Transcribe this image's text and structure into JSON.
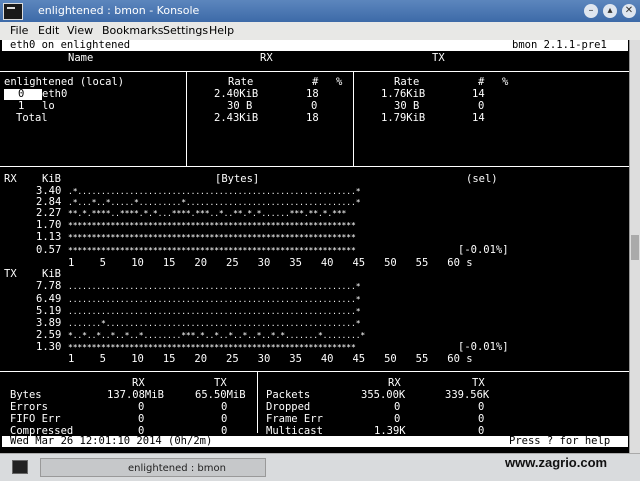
{
  "window": {
    "title": "enlightened : bmon - Konsole"
  },
  "menu": [
    "File",
    "Edit",
    "View",
    "Bookmarks",
    "Settings",
    "Help"
  ],
  "header": {
    "left": "eth0 on enlightened",
    "right": "bmon 2.1.1-pre1"
  },
  "cols": {
    "name": "Name",
    "rx": "RX",
    "tx": "TX"
  },
  "iface": {
    "host": "enlightened (local)",
    "rate_label": "Rate",
    "hash_label": "#",
    "pct_label": "%",
    "rows": [
      {
        "id": "0",
        "name": "eth0",
        "rx_rate": "2.40KiB",
        "rx_n": "18",
        "tx_rate": "1.76KiB",
        "tx_n": "14"
      },
      {
        "id": "1",
        "name": "lo",
        "rx_rate": "30 B",
        "rx_n": "0",
        "tx_rate": "30 B",
        "tx_n": "0"
      },
      {
        "id": "",
        "name": "Total",
        "rx_rate": "2.43KiB",
        "rx_n": "18",
        "tx_rate": "1.79KiB",
        "tx_n": "14"
      }
    ]
  },
  "graph": {
    "rx_label": "RX",
    "tx_label": "TX",
    "unit": "KiB",
    "title": "[Bytes]",
    "sel": "(sel)",
    "rx_rows": [
      {
        "v": "3.40",
        "s": ".*...........................................................*"
      },
      {
        "v": "2.84",
        "s": ".*...*..*.....*.........*....................................*"
      },
      {
        "v": "2.27",
        "s": "**.*.****..****.*.*...****.***..*..**.*.*......***.**.*.***"
      },
      {
        "v": "1.70",
        "s": "*************************************************************"
      },
      {
        "v": "1.13",
        "s": "*************************************************************"
      },
      {
        "v": "0.57",
        "s": "*************************************************************"
      }
    ],
    "rx_pct": "[-0.01%]",
    "tx_rows": [
      {
        "v": "7.78",
        "s": ".............................................................*"
      },
      {
        "v": "6.49",
        "s": ".............................................................*"
      },
      {
        "v": "5.19",
        "s": ".............................................................*"
      },
      {
        "v": "3.89",
        "s": ".......*.....................................................*"
      },
      {
        "v": "2.59",
        "s": "*..*..*..*..*..*........***.*..*..*..*..*..*.*.......*........*"
      },
      {
        "v": "1.30",
        "s": "*************************************************************"
      }
    ],
    "tx_pct": "[-0.01%]",
    "xaxis": "1    5    10   15   20   25   30   35   40   45   50   55   60 s"
  },
  "stats": {
    "rx": "RX",
    "tx": "TX",
    "left": [
      {
        "k": "Bytes",
        "rx": "137.08MiB",
        "tx": "65.50MiB"
      },
      {
        "k": "Errors",
        "rx": "0",
        "tx": "0"
      },
      {
        "k": "FIFO Err",
        "rx": "0",
        "tx": "0"
      },
      {
        "k": "Compressed",
        "rx": "0",
        "tx": "0"
      }
    ],
    "right": [
      {
        "k": "Packets",
        "rx": "355.00K",
        "tx": "339.56K"
      },
      {
        "k": "Dropped",
        "rx": "0",
        "tx": "0"
      },
      {
        "k": "Frame Err",
        "rx": "0",
        "tx": "0"
      },
      {
        "k": "Multicast",
        "rx": "1.39K",
        "tx": "0"
      }
    ]
  },
  "footer": {
    "left": "Wed Mar 26 12:01:10 2014 (0h/2m)",
    "right": "Press ? for help"
  },
  "taskbar": {
    "task": "enlightened : bmon"
  },
  "watermark": "www.zagrio.com"
}
